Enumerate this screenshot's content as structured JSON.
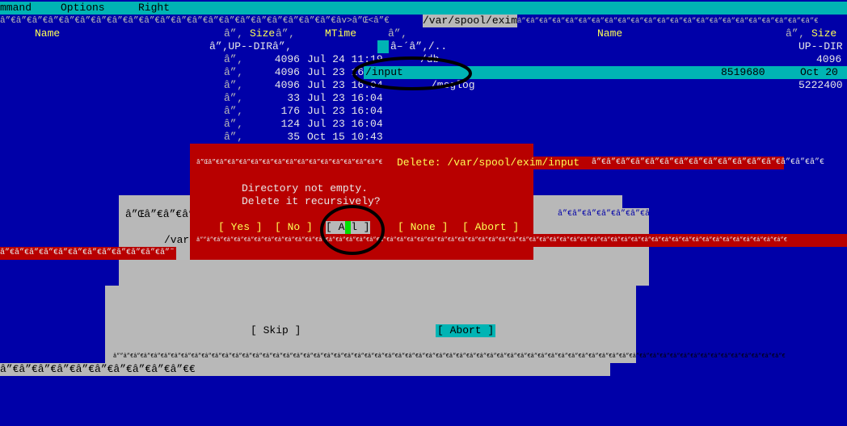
{
  "menubar": {
    "items": [
      "mmand",
      "Options",
      "Right"
    ]
  },
  "path_line": {
    "border_left": "â”€â”€â”€â”€â”€â”€â”€â”€â”€â”€â”€â”€â”€â”€â”€â”€â”€â”€â”€â”€â”€âv>â”Œ<â”€",
    "path": "/var/spool/exim",
    "border_right": "â”€â”€â”€â”€â”€â”€â”€â”€â”€â”€â”€â”€â”€â”€â”€â”€â”€â”€â”€â”€â”€â”€â”€"
  },
  "left_panel": {
    "headers": {
      "name": "Name",
      "size": "Size",
      "mtime": "MTime"
    },
    "rows": [
      {
        "size": "â”‚UP--DIRâ”‚",
        "mtime": "",
        "name": "â–´â”‚/.."
      },
      {
        "size": "4096",
        "mtime": "Jul 24 11:19",
        "name": "/db"
      },
      {
        "size": "4096",
        "mtime": "Jul 23 16",
        "name": "/input"
      },
      {
        "size": "4096",
        "mtime": "Jul 23 16:04",
        "name": "/msglog"
      },
      {
        "size": "33",
        "mtime": "Jul 23 16:04",
        "name": ""
      },
      {
        "size": "176",
        "mtime": "Jul 23 16:04",
        "name": ""
      },
      {
        "size": "124",
        "mtime": "Jul 23 16:04",
        "name": ""
      },
      {
        "size": "35",
        "mtime": "Oct 15 10:43",
        "name": ""
      }
    ]
  },
  "right_panel": {
    "headers": {
      "name": "Name",
      "size": "Size"
    },
    "rows": [
      {
        "size": "UP--DIR"
      },
      {
        "size": "4096"
      },
      {
        "size": "8519680",
        "mtime": "Oct 20"
      },
      {
        "size": "5222400"
      }
    ]
  },
  "glyphs": {
    "vbar": "â”‚",
    "hline": "â”€â”€â”€â”€â”€â”€â”€â”€â”€â”€â”€â”€â”€â”€â”€â”€â”€â”€â”€â”€â”€â”€â”€â”€â”€â”€â”€â”€â”€â”€â”€â”€â”€â”€â”€â”€â”€â”€â”€â”€",
    "corner": "â”Œâ”€â”€â”€"
  },
  "delete_dialog": {
    "title_left": "â”Œâ”€â”€â”€â”€â”€â”€â”€â”€â”€â”€â”€â”€â”€â”€â”€",
    "title": "Delete: /var/spool/exim/input",
    "title_right": "â”€â”€â”€â”€â”€â”€â”€â”€â”€â”€â”€â”€â”€â”€â”€â”€",
    "message_line1": "Directory not empty.",
    "message_line2": "Delete it recursively?",
    "buttons": {
      "yes": "[ Yes ]",
      "no": "[ No ]",
      "all": "[ All ]",
      "none": "[ None ]",
      "abort": "[ Abort ]"
    },
    "bottom_border": "â””â”€â”€â”€â”€â”€â”€â”€â”€â”€â”€â”€â”€â”€â”€â”€â”€â”€â”€â”€â”€â”€â”€â”€â”€â”€â”€â”€â”€â”€â”€â”€â”€â”€â”€â”€â”€â”€â”€â”€â”€â”€â”€â”€â”€â”€â”€â”€â”€â”€â”€â”€â”€â”€â”€â”€â”€â”€",
    "left_fragment": "â”€â”€â”€â”€â”€â”€â”€â”€â”€â”€â”€â”˜"
  },
  "back_dialog": {
    "title_fragment": "â”€â”€â”€â”€â”€â”€â”€â”€â”€â”€â”€â”€â”€â”€â”€â”€ Delete",
    "path_fragment": "/var"
  },
  "progress_dialog": {
    "skip": "[ Skip ]",
    "abort": "[ Abort ]",
    "bottom_border": "â””â”€â”€â”€â”€â”€â”€â”€â”€â”€â”€â”€â”€â”€â”€â”€â”€â”€â”€â”€â”€â”€â”€â”€â”€â”€â”€â”€â”€â”€â”€â”€â”€â”€â”€â”€â”€â”€â”€â”€â”€â”€â”€â”€â”€â”€â”€â”€â”€â”€â”€â”€â”€â”€â”€â”€â”€â”€â”€â”€â”€â”€â”€â”€â”€â”€",
    "left_fragment": "â”€â”€â”€â”€â”€â”€â”€â”€â”€â”€€"
  },
  "colors": {
    "panel_bg": "#0000a8",
    "menubar": "#00b4b4",
    "error_dialog": "#b80000",
    "dialog": "#b8b8b8",
    "highlight": "#00b4b4",
    "cursor": "#00e000"
  }
}
